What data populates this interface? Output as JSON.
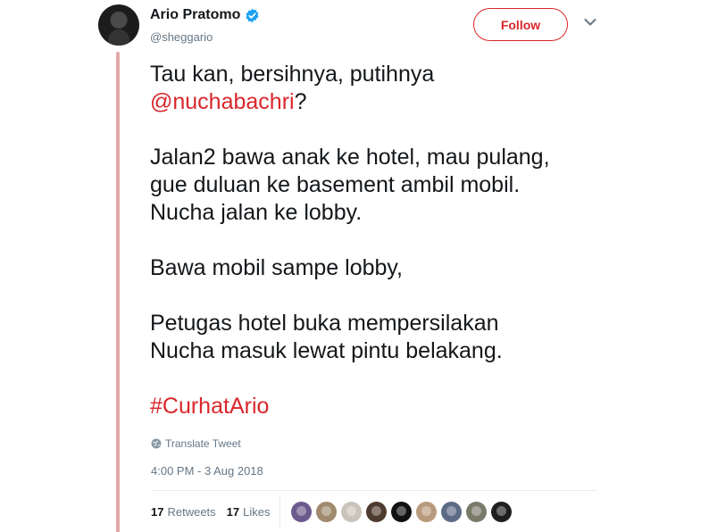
{
  "author": {
    "display_name": "Ario Pratomo",
    "handle": "@sheggario",
    "verified": true
  },
  "header": {
    "follow_label": "Follow"
  },
  "tweet": {
    "paragraphs": [
      {
        "lines": [
          "Tau kan, bersihnya, putihnya"
        ],
        "mention": "@nuchabachri",
        "mention_suffix": "?"
      },
      {
        "lines": [
          "Jalan2 bawa anak ke hotel, mau pulang,",
          "gue duluan ke basement ambil mobil.",
          "Nucha jalan ke lobby."
        ]
      },
      {
        "lines": [
          "Bawa mobil sampe lobby,"
        ]
      },
      {
        "lines": [
          "Petugas hotel buka mempersilakan",
          "Nucha masuk lewat pintu belakang."
        ]
      }
    ],
    "hashtag": "#CurhatArio",
    "translate_label": "Translate Tweet",
    "timestamp": "4:00 PM - 3 Aug 2018"
  },
  "stats": {
    "retweets_count": "17",
    "retweets_label": "Retweets",
    "likes_count": "17",
    "likes_label": "Likes"
  },
  "liker_avatars": [
    {
      "icon": "liker-avatar-icon",
      "color": "#6b5a8e"
    },
    {
      "icon": "liker-avatar-icon",
      "color": "#a08a6e"
    },
    {
      "icon": "liker-avatar-icon",
      "color": "#c9c3bb"
    },
    {
      "icon": "liker-avatar-icon",
      "color": "#4d3b2f"
    },
    {
      "icon": "liker-avatar-icon",
      "color": "#111111"
    },
    {
      "icon": "liker-avatar-icon",
      "color": "#b89b7c"
    },
    {
      "icon": "liker-avatar-icon",
      "color": "#5d6b86"
    },
    {
      "icon": "liker-avatar-icon",
      "color": "#7a7a6a"
    },
    {
      "icon": "liker-avatar-icon",
      "color": "#1e1e1e"
    }
  ],
  "colors": {
    "accent": "#d9262b",
    "verified": "#1da1f2",
    "thread_line": "#e4a8a8",
    "muted": "#657786"
  }
}
